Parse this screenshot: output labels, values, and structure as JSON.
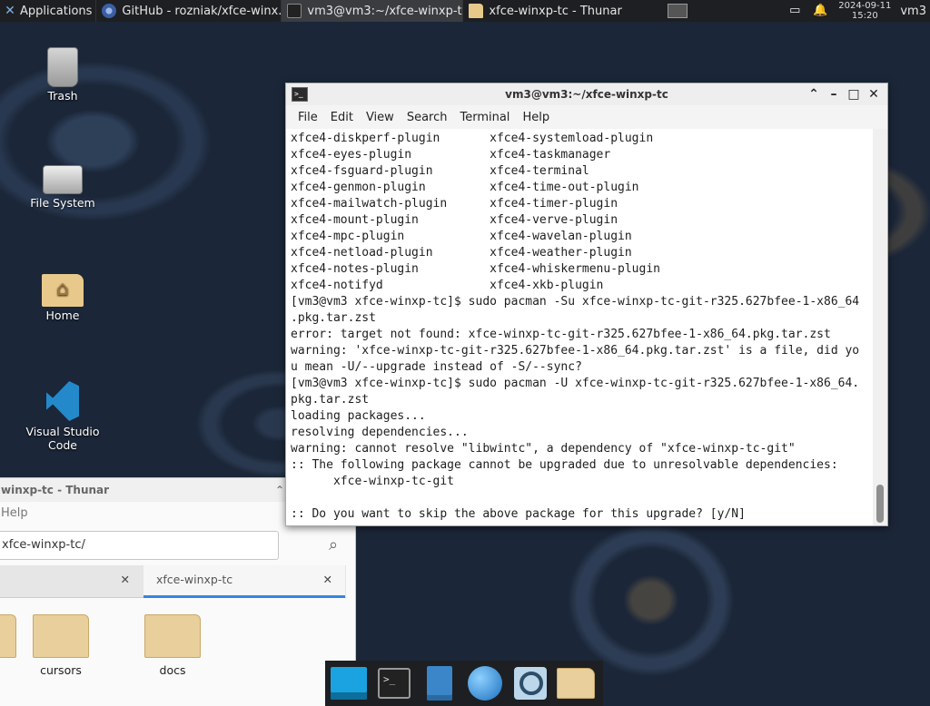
{
  "panel": {
    "apps_label": "Applications",
    "tasks": [
      {
        "label": "GitHub - rozniak/xfce-winx...",
        "icon": "browser-icon"
      },
      {
        "label": "vm3@vm3:~/xfce-winxp-tc",
        "icon": "terminal-icon"
      },
      {
        "label": "xfce-winxp-tc - Thunar",
        "icon": "folder-icon"
      }
    ],
    "date": "2024-09-11",
    "time": "15:20",
    "user": "vm3"
  },
  "desktop": {
    "icons": [
      {
        "label": "Trash"
      },
      {
        "label": "File System"
      },
      {
        "label": "Home"
      },
      {
        "label": "Visual Studio Code"
      }
    ]
  },
  "thunar": {
    "title": "winxp-tc - Thunar",
    "menu_partial": "Help",
    "path": "xfce-winxp-tc/",
    "tab_active": "xfce-winxp-tc",
    "folders": [
      "cursors",
      "docs"
    ]
  },
  "terminal": {
    "title": "vm3@vm3:~/xfce-winxp-tc",
    "menu": [
      "File",
      "Edit",
      "View",
      "Search",
      "Terminal",
      "Help"
    ],
    "lines": [
      "xfce4-diskperf-plugin       xfce4-systemload-plugin",
      "xfce4-eyes-plugin           xfce4-taskmanager",
      "xfce4-fsguard-plugin        xfce4-terminal",
      "xfce4-genmon-plugin         xfce4-time-out-plugin",
      "xfce4-mailwatch-plugin      xfce4-timer-plugin",
      "xfce4-mount-plugin          xfce4-verve-plugin",
      "xfce4-mpc-plugin            xfce4-wavelan-plugin",
      "xfce4-netload-plugin        xfce4-weather-plugin",
      "xfce4-notes-plugin          xfce4-whiskermenu-plugin",
      "xfce4-notifyd               xfce4-xkb-plugin",
      "[vm3@vm3 xfce-winxp-tc]$ sudo pacman -Su xfce-winxp-tc-git-r325.627bfee-1-x86_64",
      ".pkg.tar.zst",
      "error: target not found: xfce-winxp-tc-git-r325.627bfee-1-x86_64.pkg.tar.zst",
      "warning: 'xfce-winxp-tc-git-r325.627bfee-1-x86_64.pkg.tar.zst' is a file, did yo",
      "u mean -U/--upgrade instead of -S/--sync?",
      "[vm3@vm3 xfce-winxp-tc]$ sudo pacman -U xfce-winxp-tc-git-r325.627bfee-1-x86_64.",
      "pkg.tar.zst",
      "loading packages...",
      "resolving dependencies...",
      "warning: cannot resolve \"libwintc\", a dependency of \"xfce-winxp-tc-git\"",
      ":: The following package cannot be upgraded due to unresolvable dependencies:",
      "      xfce-winxp-tc-git",
      "",
      ":: Do you want to skip the above package for this upgrade? [y/N]"
    ]
  },
  "colors": {
    "accent": "#3584e4",
    "panel_bg": "#1e1f22",
    "desktop_bg": "#1b2638"
  }
}
